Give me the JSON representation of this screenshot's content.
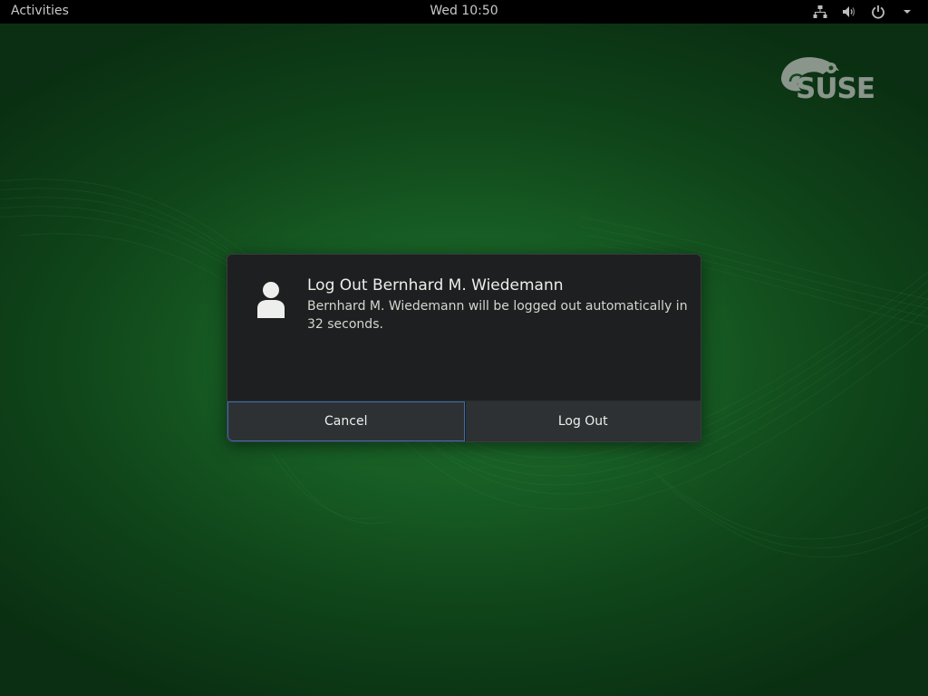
{
  "topbar": {
    "activities_label": "Activities",
    "clock": "Wed 10:50",
    "icons": [
      "network-icon",
      "volume-icon",
      "power-icon",
      "chevron-down-icon"
    ]
  },
  "desktop": {
    "logo_text": "SUSE",
    "background_color": "#175c24"
  },
  "dialog": {
    "title": "Log Out Bernhard M. Wiedemann",
    "body": "Bernhard M. Wiedemann will be logged out automatically in 32 seconds.",
    "avatar_icon": "user-avatar-icon",
    "buttons": {
      "cancel": "Cancel",
      "logout": "Log Out"
    },
    "focus_color": "#3a6fb3"
  }
}
